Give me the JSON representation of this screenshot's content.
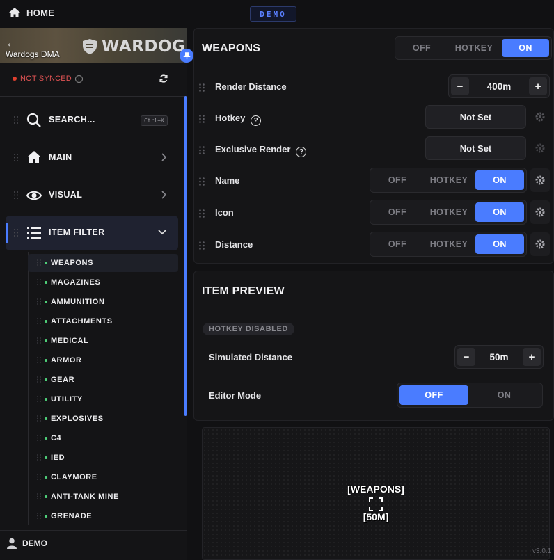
{
  "topbar": {
    "home_label": "HOME",
    "demo_badge": "DEMO"
  },
  "sidebar": {
    "banner_title": "Wardogs DMA",
    "logo_text": "WARDOGS",
    "sync_status": "NOT SYNCED",
    "nav": {
      "search": {
        "label": "SEARCH...",
        "shortcut": "Ctrl+K"
      },
      "main": "MAIN",
      "visual": "VISUAL",
      "item_filter": "ITEM FILTER"
    },
    "sub_items": [
      "WEAPONS",
      "MAGAZINES",
      "AMMUNITION",
      "ATTACHMENTS",
      "MEDICAL",
      "ARMOR",
      "GEAR",
      "UTILITY",
      "EXPLOSIVES",
      "C4",
      "IED",
      "CLAYMORE",
      "ANTI-TANK MINE",
      "GRENADE"
    ],
    "user": "DEMO",
    "status_color": "#e0402f",
    "accent": "#4a7cff"
  },
  "weapons": {
    "title": "WEAPONS",
    "mode": {
      "off": "OFF",
      "hotkey": "HOTKEY",
      "on": "ON",
      "selected": "on"
    },
    "render_distance": {
      "label": "Render Distance",
      "value": "400m"
    },
    "hotkey": {
      "label": "Hotkey",
      "value": "Not Set"
    },
    "exclusive_render": {
      "label": "Exclusive Render",
      "value": "Not Set"
    },
    "rows": [
      {
        "label": "Name",
        "off": "OFF",
        "hotkey": "HOTKEY",
        "on": "ON"
      },
      {
        "label": "Icon",
        "off": "OFF",
        "hotkey": "HOTKEY",
        "on": "ON"
      },
      {
        "label": "Distance",
        "off": "OFF",
        "hotkey": "HOTKEY",
        "on": "ON"
      }
    ]
  },
  "preview": {
    "title": "ITEM PREVIEW",
    "hotkey_disabled": "HOTKEY DISABLED",
    "simulated_distance": {
      "label": "Simulated Distance",
      "value": "50m"
    },
    "editor_mode": {
      "label": "Editor Mode",
      "off": "OFF",
      "on": "ON",
      "selected": "off"
    },
    "canvas": {
      "name": "[WEAPONS]",
      "distance": "[50M]"
    }
  },
  "version": "v3.0.1"
}
